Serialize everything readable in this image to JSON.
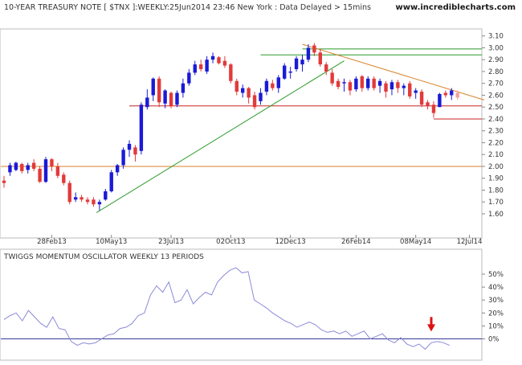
{
  "header": {
    "title": "10-YEAR TREASURY NOTE [ $TNX ]:WEEKLY:25Jun2014 23:46 New York : Data Delayed > 15mins",
    "site": "www.incrediblecharts.com"
  },
  "oscillator": {
    "title": "TWIGGS MOMENTUM OSCILLATOR WEEKLY 13 PERIODS"
  },
  "colors": {
    "up": "#1a1ad6",
    "down": "#e23a3a",
    "support_red": "#cc2222",
    "orange": "#d9822b",
    "green": "#2a9a2a",
    "osc_line": "#8a8ad8",
    "grid": "#d8d8d8",
    "arrow": "#dd1111",
    "text": "#333333"
  },
  "chart_data": [
    {
      "type": "candlestick",
      "title": "10-YEAR TREASURY NOTE [ $TNX ]:WEEKLY:25Jun2014 23:46 New York : Data Delayed > 15mins",
      "ylim": [
        1.5,
        3.15
      ],
      "y_ticks": [
        "3.10",
        "3.00",
        "2.90",
        "2.80",
        "2.70",
        "2.60",
        "2.50",
        "2.40",
        "2.30",
        "2.20",
        "2.10",
        "2.00",
        "1.90",
        "1.80",
        "1.70",
        "1.60"
      ],
      "x_ticks": [
        {
          "label": "28Feb13",
          "week": 8
        },
        {
          "label": "10May13",
          "week": 18
        },
        {
          "label": "23Jul13",
          "week": 28
        },
        {
          "label": "02Oct13",
          "week": 38
        },
        {
          "label": "12Dec13",
          "week": 48
        },
        {
          "label": "26Feb14",
          "week": 59
        },
        {
          "label": "08May14",
          "week": 69
        },
        {
          "label": "12Jul14",
          "week": 78
        }
      ],
      "candles": [
        {
          "o": 1.88,
          "h": 1.92,
          "l": 1.82,
          "c": 1.86
        },
        {
          "o": 1.95,
          "h": 2.03,
          "l": 1.92,
          "c": 2.01
        },
        {
          "o": 1.97,
          "h": 2.04,
          "l": 1.96,
          "c": 2.03
        },
        {
          "o": 2.02,
          "h": 2.03,
          "l": 1.94,
          "c": 1.96
        },
        {
          "o": 1.97,
          "h": 2.03,
          "l": 1.94,
          "c": 2.01
        },
        {
          "o": 2.03,
          "h": 2.06,
          "l": 1.96,
          "c": 1.98
        },
        {
          "o": 1.98,
          "h": 2.0,
          "l": 1.86,
          "c": 1.87
        },
        {
          "o": 1.87,
          "h": 2.08,
          "l": 1.86,
          "c": 2.06
        },
        {
          "o": 2.06,
          "h": 2.07,
          "l": 1.96,
          "c": 2.0
        },
        {
          "o": 2.0,
          "h": 2.03,
          "l": 1.9,
          "c": 1.92
        },
        {
          "o": 1.93,
          "h": 1.95,
          "l": 1.84,
          "c": 1.86
        },
        {
          "o": 1.86,
          "h": 1.88,
          "l": 1.68,
          "c": 1.7
        },
        {
          "o": 1.72,
          "h": 1.78,
          "l": 1.7,
          "c": 1.74
        },
        {
          "o": 1.74,
          "h": 1.76,
          "l": 1.7,
          "c": 1.72
        },
        {
          "o": 1.72,
          "h": 1.74,
          "l": 1.68,
          "c": 1.7
        },
        {
          "o": 1.72,
          "h": 1.74,
          "l": 1.66,
          "c": 1.68
        },
        {
          "o": 1.68,
          "h": 1.72,
          "l": 1.63,
          "c": 1.7
        },
        {
          "o": 1.72,
          "h": 1.81,
          "l": 1.71,
          "c": 1.79
        },
        {
          "o": 1.79,
          "h": 1.97,
          "l": 1.78,
          "c": 1.95
        },
        {
          "o": 1.95,
          "h": 2.02,
          "l": 1.92,
          "c": 2.01
        },
        {
          "o": 2.01,
          "h": 2.16,
          "l": 1.98,
          "c": 2.14
        },
        {
          "o": 2.14,
          "h": 2.22,
          "l": 2.08,
          "c": 2.19
        },
        {
          "o": 2.16,
          "h": 2.18,
          "l": 2.04,
          "c": 2.1
        },
        {
          "o": 2.13,
          "h": 2.54,
          "l": 2.1,
          "c": 2.52
        },
        {
          "o": 2.5,
          "h": 2.65,
          "l": 2.48,
          "c": 2.58
        },
        {
          "o": 2.6,
          "h": 2.75,
          "l": 2.55,
          "c": 2.74
        },
        {
          "o": 2.74,
          "h": 2.76,
          "l": 2.5,
          "c": 2.54
        },
        {
          "o": 2.53,
          "h": 2.65,
          "l": 2.49,
          "c": 2.64
        },
        {
          "o": 2.62,
          "h": 2.63,
          "l": 2.49,
          "c": 2.51
        },
        {
          "o": 2.52,
          "h": 2.64,
          "l": 2.5,
          "c": 2.62
        },
        {
          "o": 2.62,
          "h": 2.74,
          "l": 2.58,
          "c": 2.7
        },
        {
          "o": 2.7,
          "h": 2.82,
          "l": 2.68,
          "c": 2.79
        },
        {
          "o": 2.79,
          "h": 2.89,
          "l": 2.77,
          "c": 2.86
        },
        {
          "o": 2.86,
          "h": 2.9,
          "l": 2.8,
          "c": 2.82
        },
        {
          "o": 2.8,
          "h": 2.93,
          "l": 2.78,
          "c": 2.9
        },
        {
          "o": 2.9,
          "h": 2.96,
          "l": 2.87,
          "c": 2.93
        },
        {
          "o": 2.92,
          "h": 2.93,
          "l": 2.86,
          "c": 2.87
        },
        {
          "o": 2.89,
          "h": 2.93,
          "l": 2.83,
          "c": 2.85
        },
        {
          "o": 2.86,
          "h": 2.87,
          "l": 2.7,
          "c": 2.72
        },
        {
          "o": 2.72,
          "h": 2.74,
          "l": 2.6,
          "c": 2.63
        },
        {
          "o": 2.62,
          "h": 2.69,
          "l": 2.58,
          "c": 2.66
        },
        {
          "o": 2.66,
          "h": 2.67,
          "l": 2.53,
          "c": 2.58
        },
        {
          "o": 2.6,
          "h": 2.63,
          "l": 2.48,
          "c": 2.5
        },
        {
          "o": 2.55,
          "h": 2.66,
          "l": 2.52,
          "c": 2.62
        },
        {
          "o": 2.63,
          "h": 2.74,
          "l": 2.6,
          "c": 2.72
        },
        {
          "o": 2.7,
          "h": 2.73,
          "l": 2.64,
          "c": 2.66
        },
        {
          "o": 2.66,
          "h": 2.77,
          "l": 2.62,
          "c": 2.75
        },
        {
          "o": 2.74,
          "h": 2.87,
          "l": 2.73,
          "c": 2.85
        },
        {
          "o": 2.79,
          "h": 2.84,
          "l": 2.74,
          "c": 2.8
        },
        {
          "o": 2.82,
          "h": 2.93,
          "l": 2.8,
          "c": 2.91
        },
        {
          "o": 2.86,
          "h": 2.94,
          "l": 2.8,
          "c": 2.9
        },
        {
          "o": 2.9,
          "h": 3.03,
          "l": 2.88,
          "c": 3.0
        },
        {
          "o": 3.02,
          "h": 3.04,
          "l": 2.93,
          "c": 2.96
        },
        {
          "o": 2.96,
          "h": 2.99,
          "l": 2.84,
          "c": 2.86
        },
        {
          "o": 2.86,
          "h": 2.88,
          "l": 2.77,
          "c": 2.8
        },
        {
          "o": 2.79,
          "h": 2.82,
          "l": 2.68,
          "c": 2.7
        },
        {
          "o": 2.72,
          "h": 2.74,
          "l": 2.65,
          "c": 2.67
        },
        {
          "o": 2.7,
          "h": 2.74,
          "l": 2.63,
          "c": 2.71
        },
        {
          "o": 2.71,
          "h": 2.73,
          "l": 2.6,
          "c": 2.64
        },
        {
          "o": 2.65,
          "h": 2.76,
          "l": 2.63,
          "c": 2.74
        },
        {
          "o": 2.76,
          "h": 2.77,
          "l": 2.63,
          "c": 2.66
        },
        {
          "o": 2.66,
          "h": 2.76,
          "l": 2.64,
          "c": 2.74
        },
        {
          "o": 2.74,
          "h": 2.76,
          "l": 2.64,
          "c": 2.66
        },
        {
          "o": 2.68,
          "h": 2.74,
          "l": 2.62,
          "c": 2.72
        },
        {
          "o": 2.7,
          "h": 2.72,
          "l": 2.58,
          "c": 2.63
        },
        {
          "o": 2.65,
          "h": 2.73,
          "l": 2.6,
          "c": 2.71
        },
        {
          "o": 2.71,
          "h": 2.73,
          "l": 2.62,
          "c": 2.66
        },
        {
          "o": 2.66,
          "h": 2.7,
          "l": 2.6,
          "c": 2.68
        },
        {
          "o": 2.7,
          "h": 2.72,
          "l": 2.57,
          "c": 2.59
        },
        {
          "o": 2.62,
          "h": 2.66,
          "l": 2.57,
          "c": 2.64
        },
        {
          "o": 2.63,
          "h": 2.65,
          "l": 2.5,
          "c": 2.52
        },
        {
          "o": 2.54,
          "h": 2.56,
          "l": 2.48,
          "c": 2.51
        },
        {
          "o": 2.52,
          "h": 2.55,
          "l": 2.41,
          "c": 2.45
        },
        {
          "o": 2.5,
          "h": 2.62,
          "l": 2.5,
          "c": 2.61
        },
        {
          "o": 2.62,
          "h": 2.64,
          "l": 2.58,
          "c": 2.6
        },
        {
          "o": 2.6,
          "h": 2.66,
          "l": 2.56,
          "c": 2.64
        },
        {
          "o": 2.62,
          "h": 2.64,
          "l": 2.56,
          "c": 2.58
        }
      ],
      "horizontal_lines": [
        {
          "y": 2.94,
          "x_from_week": 43,
          "color": "green"
        },
        {
          "y": 2.99,
          "x_from_week": 50,
          "color": "green"
        },
        {
          "y": 2.51,
          "x_from_week": 21,
          "color": "red"
        },
        {
          "y": 2.4,
          "x_from_week": 72,
          "color": "red"
        },
        {
          "y": 2.0,
          "x_from_week": 0,
          "color": "orange"
        }
      ],
      "trend_lines": [
        {
          "from_week": 15.5,
          "from_y": 1.61,
          "to_week": 57,
          "to_y": 2.89,
          "color": "green"
        },
        {
          "from_week": 50,
          "from_y": 3.03,
          "to_week": 80.5,
          "to_y": 2.56,
          "color": "orange"
        }
      ],
      "grid": false
    },
    {
      "type": "line",
      "title": "TWIGGS MOMENTUM OSCILLATOR WEEKLY 13 PERIODS",
      "ylim": [
        -10,
        60
      ],
      "y_ticks": [
        "50%",
        "40%",
        "30%",
        "20%",
        "10%",
        "0%"
      ],
      "zero_line": true,
      "values": [
        15,
        18,
        20,
        14,
        22,
        17,
        12,
        9,
        17,
        8,
        7,
        -2,
        -5,
        -3,
        -4,
        -3,
        0,
        3,
        4,
        8,
        9,
        12,
        18,
        20,
        34,
        41,
        36,
        44,
        28,
        30,
        38,
        27,
        32,
        36,
        34,
        44,
        49,
        53,
        55,
        51,
        52,
        30,
        27,
        24,
        20,
        17,
        14,
        12,
        9,
        11,
        13,
        11,
        7,
        5,
        6,
        4,
        6,
        2,
        4,
        6,
        0,
        2,
        4,
        -1,
        -3,
        1,
        -4,
        -6,
        -4,
        -8,
        -3,
        -2,
        -3,
        -5
      ],
      "annotations": [
        {
          "type": "arrow",
          "direction": "down",
          "week": 70,
          "color": "red"
        }
      ]
    }
  ]
}
